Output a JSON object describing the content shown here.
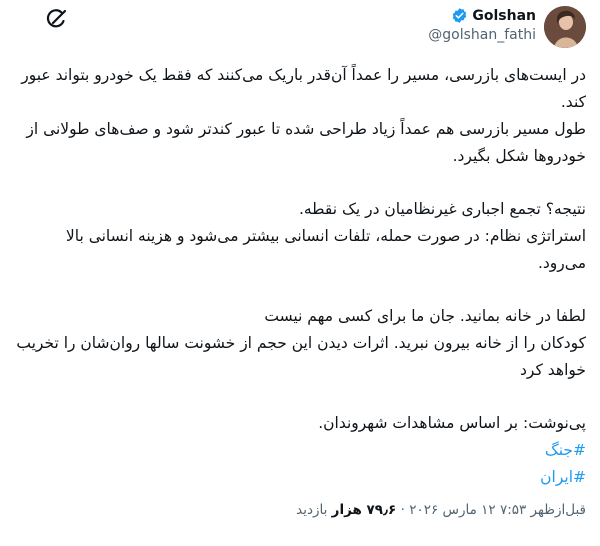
{
  "author": {
    "display_name": "Golshan",
    "handle": "@golshan_fathi",
    "verified": true,
    "avatar_icon": "profile-photo",
    "verified_icon": "blue-check-badge"
  },
  "tweet": {
    "paragraphs": [
      "در ایست‌های بازرسی، مسیر را عمداً آن‌قدر باریک می‌کنند که فقط یک خودرو بتواند عبور کند.",
      "طول مسیر بازرسی هم عمداً زیاد طراحی شده تا عبور کندتر شود و صف‌های طولانی از خودروها شکل بگیرد.",
      "",
      "نتیجه؟ تجمع اجباری غیرنظامیان در یک نقطه.",
      "استراتژی نظام: در صورت حمله، تلفات انسانی بیشتر می‌شود و هزینه انسانی بالا می‌رود.",
      "",
      "لطفا در خانه بمانید. جان ما برای کسی مهم نیست",
      "کودکان را از خانه بیرون نبرید. اثرات دیدن این حجم از خشونت سالها روان‌شان را تخریب خواهد کرد",
      "",
      "پی‌نوشت: بر اساس مشاهدات شهروندان."
    ],
    "hashtags": [
      "#جنگ",
      "#ایران"
    ]
  },
  "meta": {
    "time": "قبل‌ازظهر ۷:۵۳",
    "date": "۱۲ مارس ۲۰۲۶",
    "separator": "·",
    "views_count": "۷۹٫۶ هزار",
    "views_label": "بازدید"
  },
  "toolbar": {
    "grok_icon": "grok-icon"
  }
}
